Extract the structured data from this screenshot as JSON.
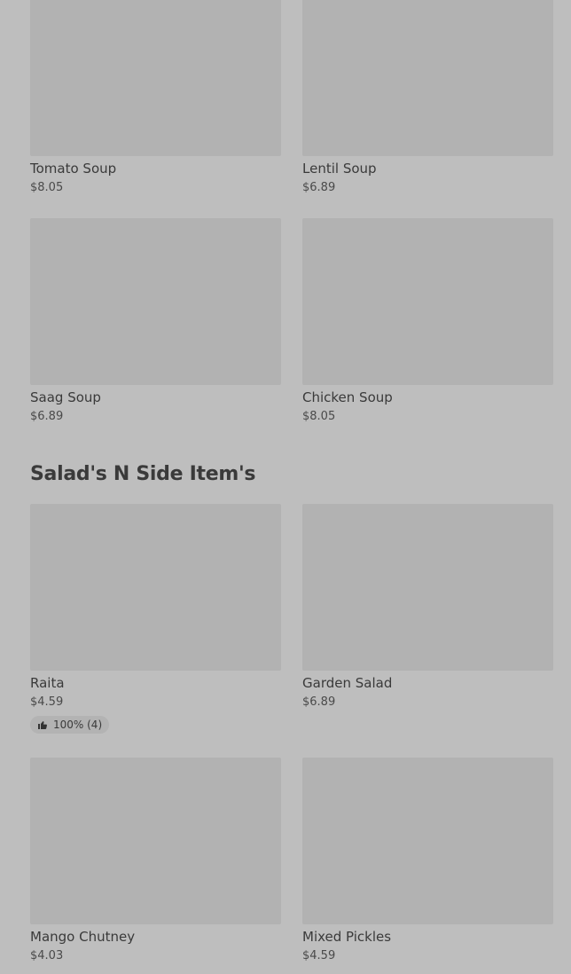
{
  "soups": [
    {
      "name": "Tomato Soup",
      "price": "$8.05"
    },
    {
      "name": "Lentil Soup",
      "price": "$6.89"
    },
    {
      "name": "Saag Soup",
      "price": "$6.89"
    },
    {
      "name": "Chicken Soup",
      "price": "$8.05"
    }
  ],
  "section": {
    "title": "Salad's N Side Item's"
  },
  "sides": [
    {
      "name": "Raita",
      "price": "$4.59",
      "rating": "100% (4)"
    },
    {
      "name": "Garden Salad",
      "price": "$6.89"
    },
    {
      "name": "Mango Chutney",
      "price": "$4.03"
    },
    {
      "name": "Mixed Pickles",
      "price": "$4.59"
    }
  ],
  "icons": {
    "rating": "thumbs-up-icon"
  },
  "colors": {
    "background": "#bebebe",
    "image_placeholder": "#b2b2b2",
    "text": "#3a3a3a"
  }
}
